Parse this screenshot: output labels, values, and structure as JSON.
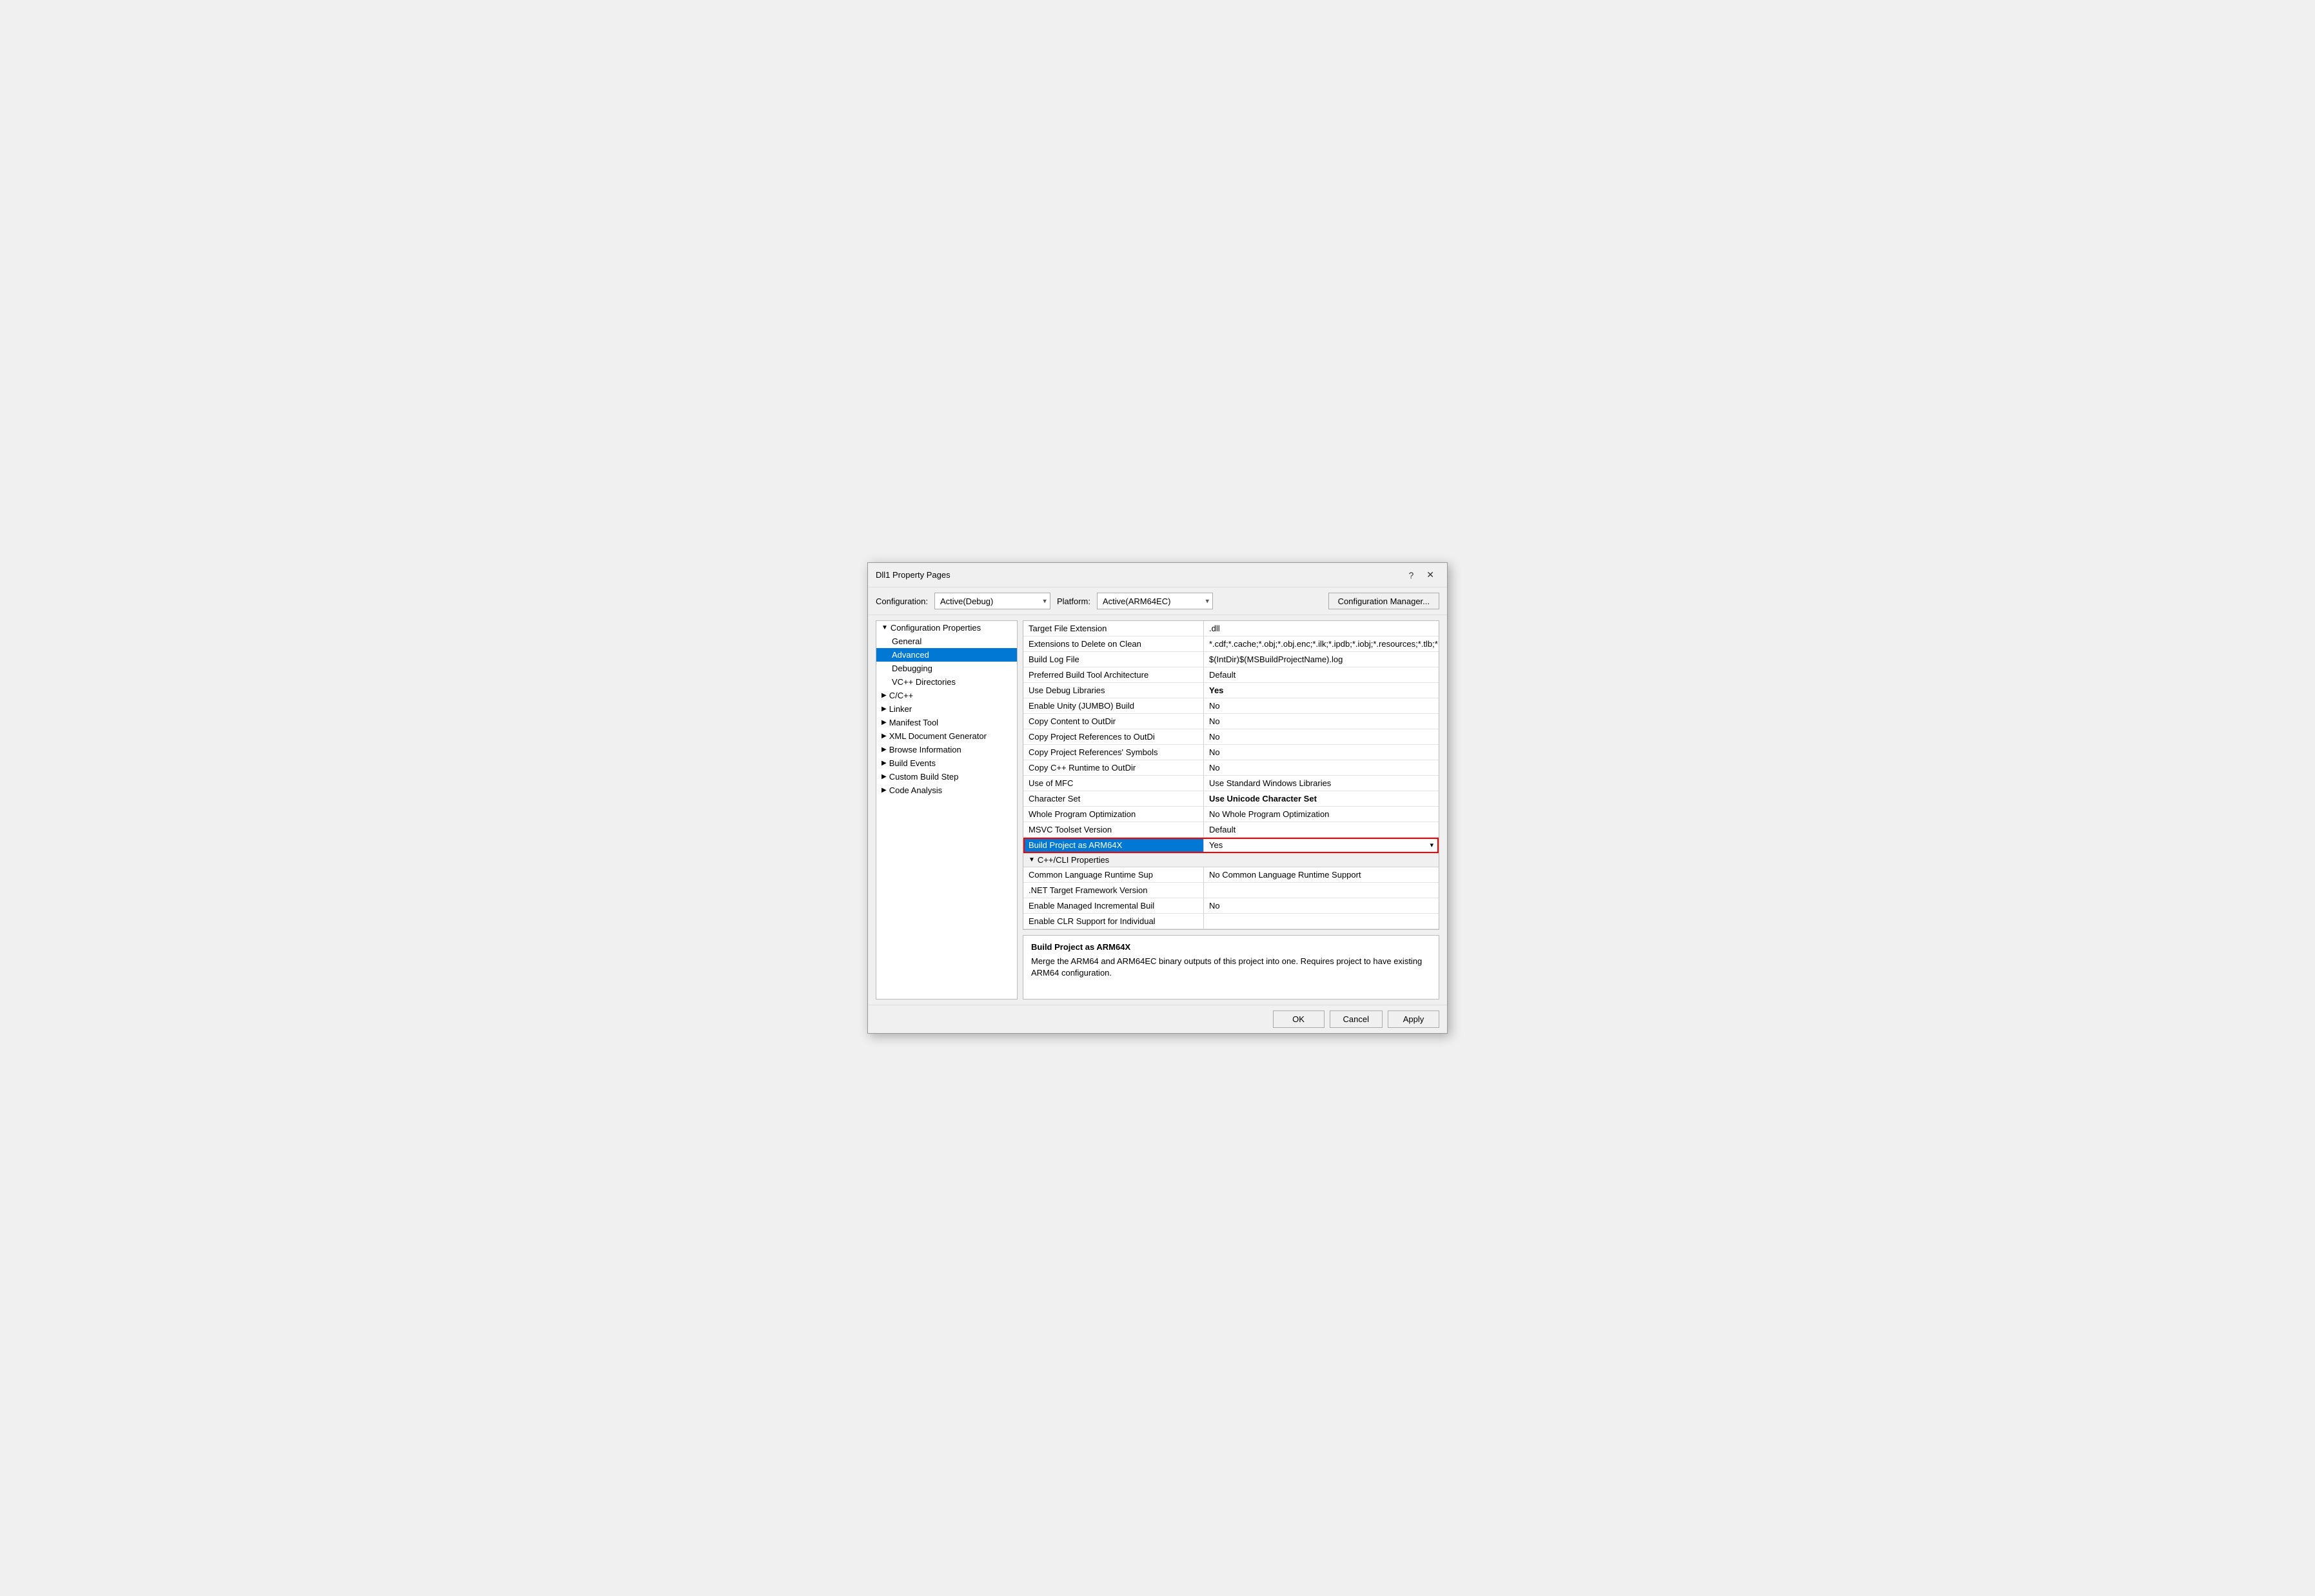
{
  "dialog": {
    "title": "Dll1 Property Pages",
    "help_btn": "?",
    "close_btn": "✕"
  },
  "config_bar": {
    "configuration_label": "Configuration:",
    "configuration_value": "Active(Debug)",
    "platform_label": "Platform:",
    "platform_value": "Active(ARM64EC)",
    "config_manager_label": "Configuration Manager..."
  },
  "sidebar": {
    "items": [
      {
        "id": "config-props",
        "label": "Configuration Properties",
        "level": "parent",
        "expanded": true,
        "triangle": "▼"
      },
      {
        "id": "general",
        "label": "General",
        "level": "child",
        "selected": false
      },
      {
        "id": "advanced",
        "label": "Advanced",
        "level": "child",
        "selected": true
      },
      {
        "id": "debugging",
        "label": "Debugging",
        "level": "child",
        "selected": false
      },
      {
        "id": "vc-dirs",
        "label": "VC++ Directories",
        "level": "child",
        "selected": false
      },
      {
        "id": "cpp",
        "label": "C/C++",
        "level": "parent-child",
        "triangle": "▶"
      },
      {
        "id": "linker",
        "label": "Linker",
        "level": "parent-child",
        "triangle": "▶"
      },
      {
        "id": "manifest",
        "label": "Manifest Tool",
        "level": "parent-child",
        "triangle": "▶"
      },
      {
        "id": "xml-gen",
        "label": "XML Document Generator",
        "level": "parent-child",
        "triangle": "▶"
      },
      {
        "id": "browse",
        "label": "Browse Information",
        "level": "parent-child",
        "triangle": "▶"
      },
      {
        "id": "build-events",
        "label": "Build Events",
        "level": "parent-child",
        "triangle": "▶"
      },
      {
        "id": "custom-build",
        "label": "Custom Build Step",
        "level": "parent-child",
        "triangle": "▶"
      },
      {
        "id": "code-analysis",
        "label": "Code Analysis",
        "level": "parent-child",
        "triangle": "▶"
      }
    ]
  },
  "property_grid": {
    "rows": [
      {
        "name": "Target File Extension",
        "value": ".dll",
        "bold": false
      },
      {
        "name": "Extensions to Delete on Clean",
        "value": "*.cdf;*.cache;*.obj;*.obj.enc;*.ilk;*.ipdb;*.iobj;*.resources;*.tlb;*.tli;*.t",
        "bold": false
      },
      {
        "name": "Build Log File",
        "value": "$(IntDir)$(MSBuildProjectName).log",
        "bold": false
      },
      {
        "name": "Preferred Build Tool Architecture",
        "value": "Default",
        "bold": false
      },
      {
        "name": "Use Debug Libraries",
        "value": "Yes",
        "bold": true
      },
      {
        "name": "Enable Unity (JUMBO) Build",
        "value": "No",
        "bold": false
      },
      {
        "name": "Copy Content to OutDir",
        "value": "No",
        "bold": false
      },
      {
        "name": "Copy Project References to OutDi",
        "value": "No",
        "bold": false
      },
      {
        "name": "Copy Project References' Symbols",
        "value": "No",
        "bold": false
      },
      {
        "name": "Copy C++ Runtime to OutDir",
        "value": "No",
        "bold": false
      },
      {
        "name": "Use of MFC",
        "value": "Use Standard Windows Libraries",
        "bold": false
      },
      {
        "name": "Character Set",
        "value": "Use Unicode Character Set",
        "bold": true
      },
      {
        "name": "Whole Program Optimization",
        "value": "No Whole Program Optimization",
        "bold": false
      },
      {
        "name": "MSVC Toolset Version",
        "value": "Default",
        "bold": false
      }
    ],
    "highlighted_row": {
      "name": "Build Project as ARM64X",
      "value": "Yes",
      "has_dropdown": true
    },
    "section_cpp_cli": {
      "label": "C++/CLI Properties",
      "triangle": "▼"
    },
    "cpp_cli_rows": [
      {
        "name": "Common Language Runtime Sup",
        "value": "No Common Language Runtime Support",
        "bold": false
      },
      {
        "name": ".NET Target Framework Version",
        "value": "",
        "bold": false
      },
      {
        "name": "Enable Managed Incremental Buil",
        "value": "No",
        "bold": false
      },
      {
        "name": "Enable CLR Support for Individual",
        "value": "",
        "bold": false
      }
    ]
  },
  "description": {
    "title": "Build Project as ARM64X",
    "text": "Merge the ARM64 and ARM64EC binary outputs of this project into one. Requires project to have existing ARM64 configuration."
  },
  "buttons": {
    "ok": "OK",
    "cancel": "Cancel",
    "apply": "Apply"
  }
}
